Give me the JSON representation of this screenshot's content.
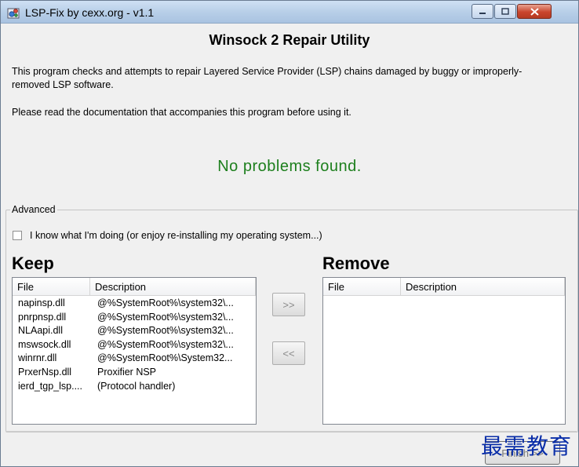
{
  "window": {
    "title": "LSP-Fix by cexx.org - v1.1",
    "icons": {
      "app": "app-gears-icon",
      "minimize": "minimize-icon",
      "maximize": "maximize-icon",
      "close": "close-icon"
    }
  },
  "main": {
    "heading": "Winsock 2 Repair Utility",
    "description": "This program checks and attempts to repair Layered Service Provider (LSP) chains damaged by buggy or improperly-removed LSP software.",
    "note": "Please read the documentation that accompanies this program before using it.",
    "status": "No problems found.",
    "status_color": "#1d7f1d"
  },
  "advanced": {
    "label": "Advanced",
    "checkbox_label": "I know what I'm doing (or enjoy re-installing my operating system...)",
    "checkbox_checked": false
  },
  "keep": {
    "title": "Keep",
    "columns": [
      "File",
      "Description"
    ],
    "rows": [
      [
        "napinsp.dll",
        "@%SystemRoot%\\system32\\..."
      ],
      [
        "pnrpnsp.dll",
        "@%SystemRoot%\\system32\\..."
      ],
      [
        "NLAapi.dll",
        "@%SystemRoot%\\system32\\..."
      ],
      [
        "mswsock.dll",
        "@%SystemRoot%\\system32\\..."
      ],
      [
        "winrnr.dll",
        "@%SystemRoot%\\System32..."
      ],
      [
        "PrxerNsp.dll",
        "Proxifier NSP"
      ],
      [
        "ierd_tgp_lsp....",
        "(Protocol handler)"
      ]
    ]
  },
  "remove": {
    "title": "Remove",
    "columns": [
      "File",
      "Description"
    ],
    "rows": []
  },
  "buttons": {
    "move_to_remove": ">>",
    "move_to_keep": "<<",
    "action": "Finish >>"
  },
  "watermark": "最需教育"
}
